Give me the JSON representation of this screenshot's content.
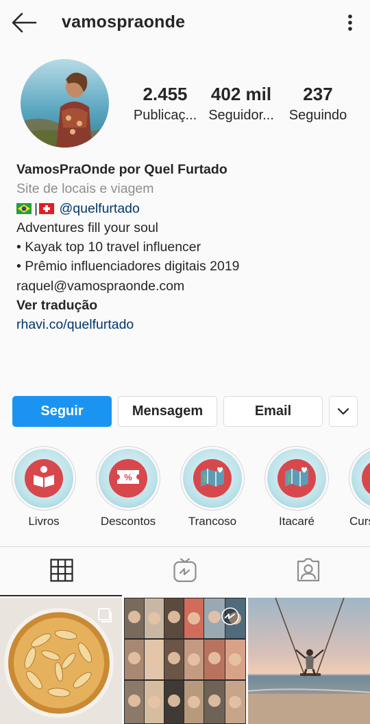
{
  "header": {
    "username": "vamospraonde",
    "back_icon": "arrow-left-icon",
    "more_icon": "more-vertical-icon"
  },
  "profile": {
    "avatar": "profile-photo",
    "stats": [
      {
        "value": "2.455",
        "label": "Publicaç..."
      },
      {
        "value": "402 mil",
        "label": "Seguidor..."
      },
      {
        "value": "237",
        "label": "Seguindo"
      }
    ]
  },
  "bio": {
    "name": "VamosPraOnde por Quel Furtado",
    "category": "Site de locais e viagem",
    "flags": [
      "brazil-flag",
      "switzerland-flag"
    ],
    "flag_separator": "|",
    "mention": "@quelfurtado",
    "lines": [
      "Adventures fill your soul",
      "• Kayak top 10 travel influencer",
      "• Prêmio influenciadores digitais 2019",
      "raquel@vamospraonde.com"
    ],
    "see_translation": "Ver tradução",
    "link": "rhavi.co/quelfurtado"
  },
  "actions": {
    "follow": "Seguir",
    "message": "Mensagem",
    "email": "Email",
    "more_icon": "chevron-down-icon"
  },
  "highlights": [
    {
      "label": "Livros",
      "icon": "book-reader-icon"
    },
    {
      "label": "Descontos",
      "icon": "discount-ticket-icon"
    },
    {
      "label": "Trancoso",
      "icon": "map-heart-icon"
    },
    {
      "label": "Itacaré",
      "icon": "map-heart-icon"
    },
    {
      "label": "Curs",
      "icon": "highlight-icon"
    }
  ],
  "tabs": [
    {
      "name": "grid",
      "icon": "grid-icon",
      "active": true
    },
    {
      "name": "igtv",
      "icon": "igtv-icon",
      "active": false
    },
    {
      "name": "tagged",
      "icon": "tagged-user-icon",
      "active": false
    }
  ],
  "grid_posts": [
    {
      "subject": "apple-tart",
      "multi": true
    },
    {
      "subject": "video-call-collage",
      "multi": true
    },
    {
      "subject": "beach-swing",
      "multi": false
    }
  ],
  "colors": {
    "primary_button": "#1a94f0",
    "link": "#00376b",
    "secondary_text": "#8e8e8e",
    "highlight_badge": "#d8474c"
  }
}
